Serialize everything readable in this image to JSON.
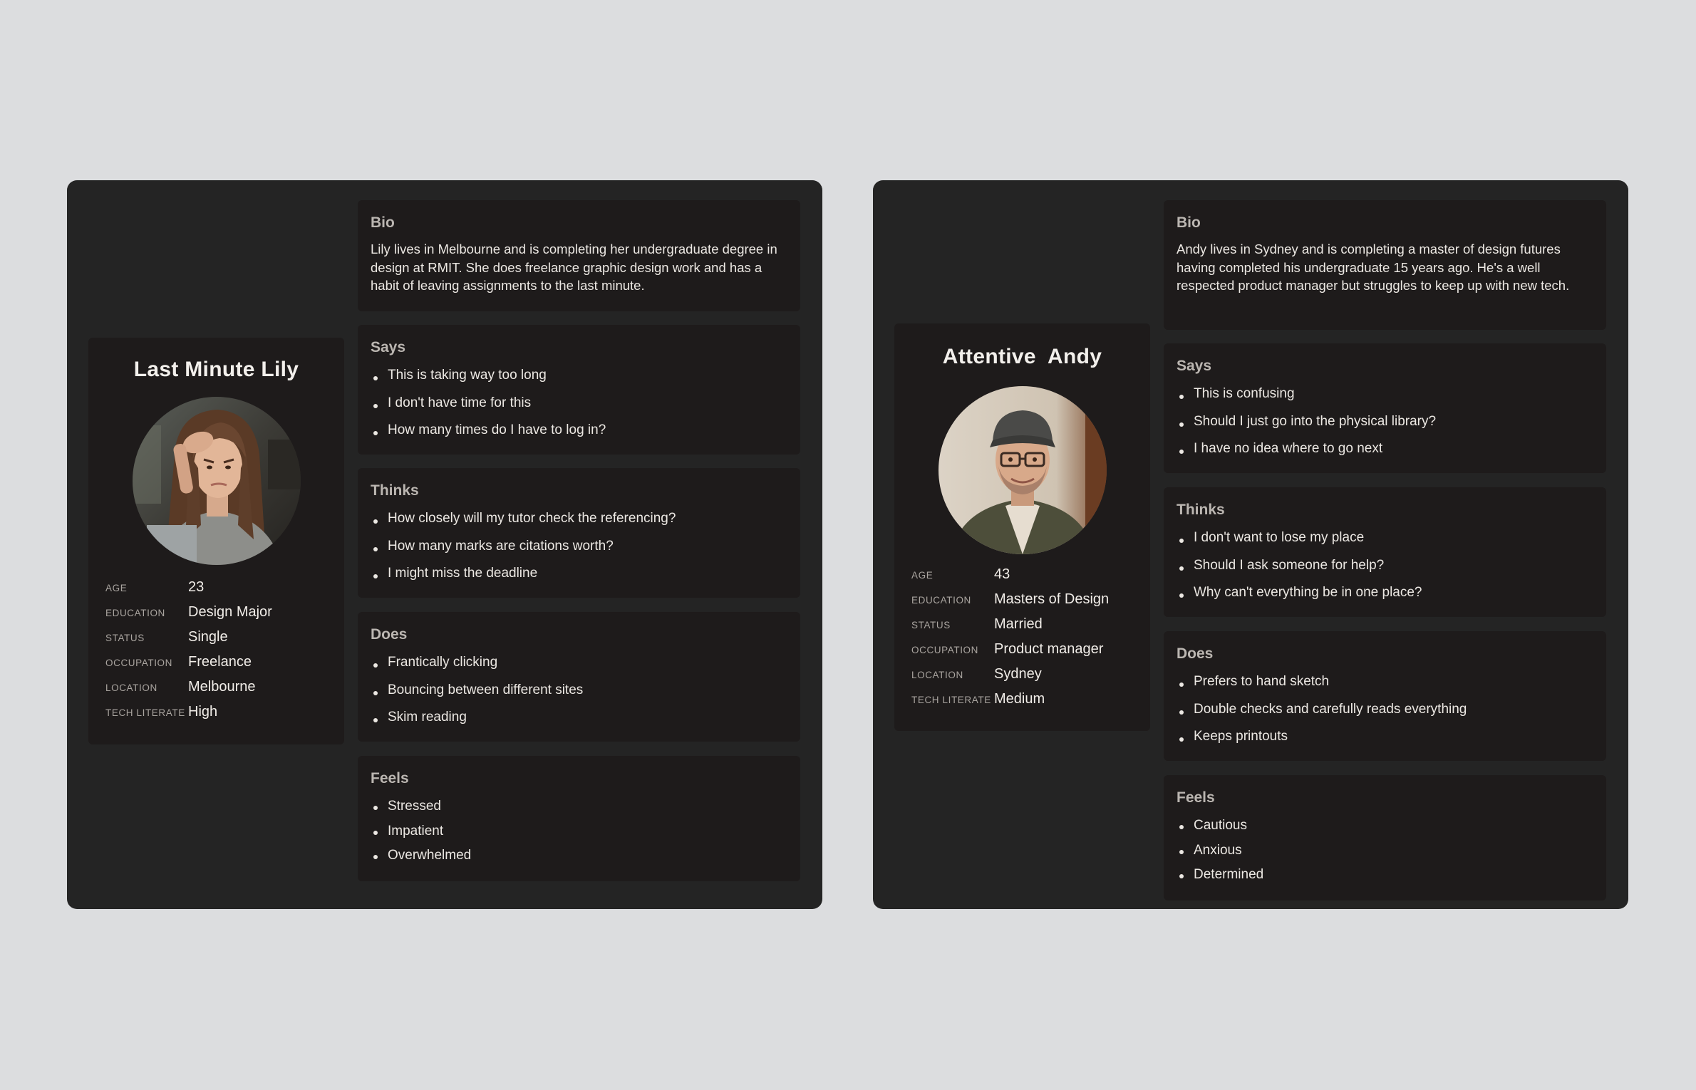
{
  "colors": {
    "page_background": "#dcdddf",
    "card_background": "#242424",
    "panel_background": "#1e1b1b",
    "text_primary": "#ece8e3",
    "text_muted": "#bbb6b1"
  },
  "personas": [
    {
      "name": "Last Minute Lily",
      "avatar_icon": "stressed-woman-photo",
      "attributes": [
        {
          "key": "AGE",
          "value": "23"
        },
        {
          "key": "EDUCATION",
          "value": "Design Major"
        },
        {
          "key": "STATUS",
          "value": "Single"
        },
        {
          "key": "OCCUPATION",
          "value": "Freelance"
        },
        {
          "key": "LOCATION",
          "value": "Melbourne"
        },
        {
          "key": "TECH LITERATE",
          "value": "High"
        }
      ],
      "bio": {
        "title": "Bio",
        "text": "Lily lives in Melbourne and is completing her undergraduate degree in design at RMIT. She does freelance graphic design work and has a habit of leaving assignments to the last minute."
      },
      "says": {
        "title": "Says",
        "items": [
          "This is taking way too long",
          "I don't have time for this",
          "How many times do I have to log in?"
        ]
      },
      "thinks": {
        "title": "Thinks",
        "items": [
          "How closely will my tutor check the referencing?",
          "How many marks are citations worth?",
          "I might miss the deadline"
        ]
      },
      "does": {
        "title": "Does",
        "items": [
          "Frantically clicking",
          "Bouncing between different sites",
          "Skim reading"
        ]
      },
      "feels": {
        "title": "Feels",
        "items": [
          "Stressed",
          "Impatient",
          "Overwhelmed"
        ]
      }
    },
    {
      "name": "Attentive  Andy",
      "avatar_icon": "smiling-man-with-cap-photo",
      "attributes": [
        {
          "key": "AGE",
          "value": "43"
        },
        {
          "key": "EDUCATION",
          "value": "Masters of Design"
        },
        {
          "key": "STATUS",
          "value": "Married"
        },
        {
          "key": "OCCUPATION",
          "value": "Product manager"
        },
        {
          "key": "LOCATION",
          "value": "Sydney"
        },
        {
          "key": "TECH LITERATE",
          "value": "Medium"
        }
      ],
      "bio": {
        "title": "Bio",
        "text": "Andy lives in Sydney and is completing a master of design futures having completed his undergraduate 15 years ago. He's a well respected product manager but struggles to keep up with new tech."
      },
      "says": {
        "title": "Says",
        "items": [
          "This is confusing",
          "Should I just go into the physical library?",
          "I have no idea where to go next"
        ]
      },
      "thinks": {
        "title": "Thinks",
        "items": [
          "I don't want to lose my place",
          "Should I ask someone for help?",
          "Why can't everything be in one place?"
        ]
      },
      "does": {
        "title": "Does",
        "items": [
          "Prefers to hand sketch",
          "Double checks and carefully reads everything",
          "Keeps printouts"
        ]
      },
      "feels": {
        "title": "Feels",
        "items": [
          "Cautious",
          "Anxious",
          "Determined"
        ]
      }
    }
  ]
}
